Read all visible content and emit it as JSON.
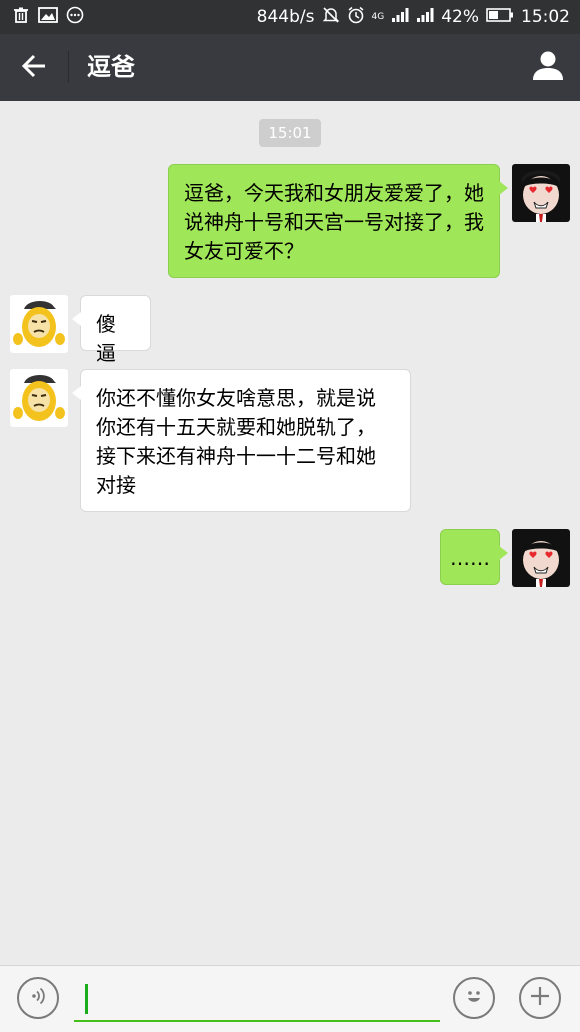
{
  "status_bar": {
    "net_speed": "844b/s",
    "network": "4G",
    "battery": "42%",
    "time": "15:02"
  },
  "header": {
    "title": "逗爸"
  },
  "chat": {
    "timestamp": "15:01",
    "messages": [
      {
        "sender": "me",
        "text": "逗爸，今天我和女朋友爱爱了，她说神舟十号和天宫一号对接了，我女友可爱不？"
      },
      {
        "sender": "other",
        "text": "傻逼"
      },
      {
        "sender": "other",
        "text": "你还不懂你女友啥意思，就是说你还有十五天就要和她脱轨了，接下来还有神舟十一十二号和她对接"
      },
      {
        "sender": "me",
        "text": "……"
      }
    ]
  },
  "input": {
    "placeholder": ""
  },
  "icons": {
    "back": "arrow-left-icon",
    "profile": "person-icon",
    "voice": "voice-icon",
    "emoji": "emoji-icon",
    "add": "plus-icon"
  },
  "colors": {
    "status_bar": "#303233",
    "nav_bar": "#393a3f",
    "chat_bg": "#ebebeb",
    "my_bubble": "#9fe658",
    "their_bubble": "#ffffff",
    "input_accent": "#45c01a"
  }
}
